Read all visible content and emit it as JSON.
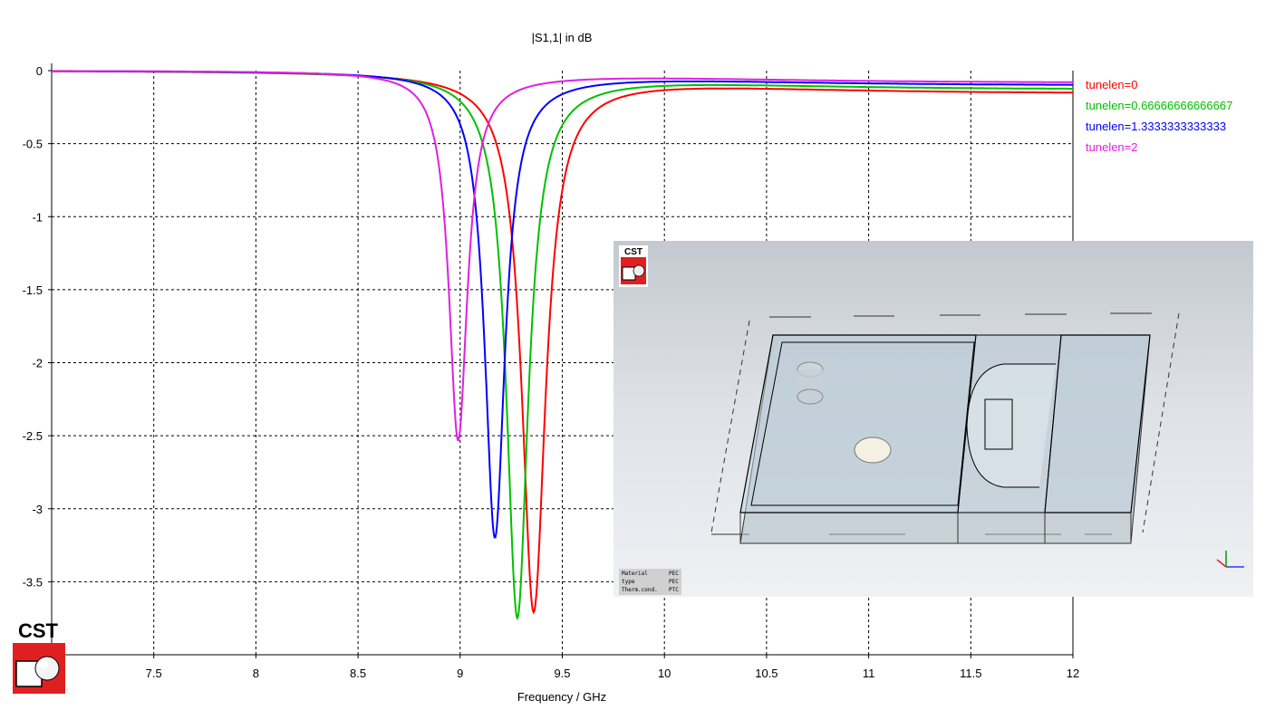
{
  "chart_data": {
    "type": "line",
    "title": "|S1,1| in dB",
    "xlabel": "Frequency / GHz",
    "ylabel": "",
    "xlim": [
      7.0,
      12.0
    ],
    "ylim": [
      -4.0,
      0.0
    ],
    "x_ticks": [
      "7.5",
      "8",
      "8.5",
      "9",
      "9.5",
      "10",
      "10.5",
      "11",
      "11.5",
      "12"
    ],
    "y_ticks": [
      "0",
      "-0.5",
      "-1",
      "-1.5",
      "-2",
      "-2.5",
      "-3",
      "-3.5"
    ],
    "grid": true,
    "legend_position": "right",
    "series": [
      {
        "name": "tunelen=0",
        "color": "#ff0000",
        "f0": 9.36,
        "min": -3.67,
        "hw": 0.07,
        "tail": -0.17
      },
      {
        "name": "tunelen=0.66666666666667",
        "color": "#00c000",
        "f0": 9.28,
        "min": -3.72,
        "hw": 0.065,
        "tail": -0.14
      },
      {
        "name": "tunelen=1.3333333333333",
        "color": "#0000ff",
        "f0": 9.17,
        "min": -3.18,
        "hw": 0.06,
        "tail": -0.11
      },
      {
        "name": "tunelen=2",
        "color": "#e020e0",
        "f0": 8.99,
        "min": -2.52,
        "hw": 0.055,
        "tail": -0.09
      }
    ]
  },
  "logo": {
    "text": "CST"
  },
  "inset": {
    "logo_text": "CST",
    "material_table": [
      {
        "key": "Material",
        "value": "PEC"
      },
      {
        "key": "type",
        "value": "PEC"
      },
      {
        "key": "Therm.cond.",
        "value": "PTC"
      }
    ]
  }
}
